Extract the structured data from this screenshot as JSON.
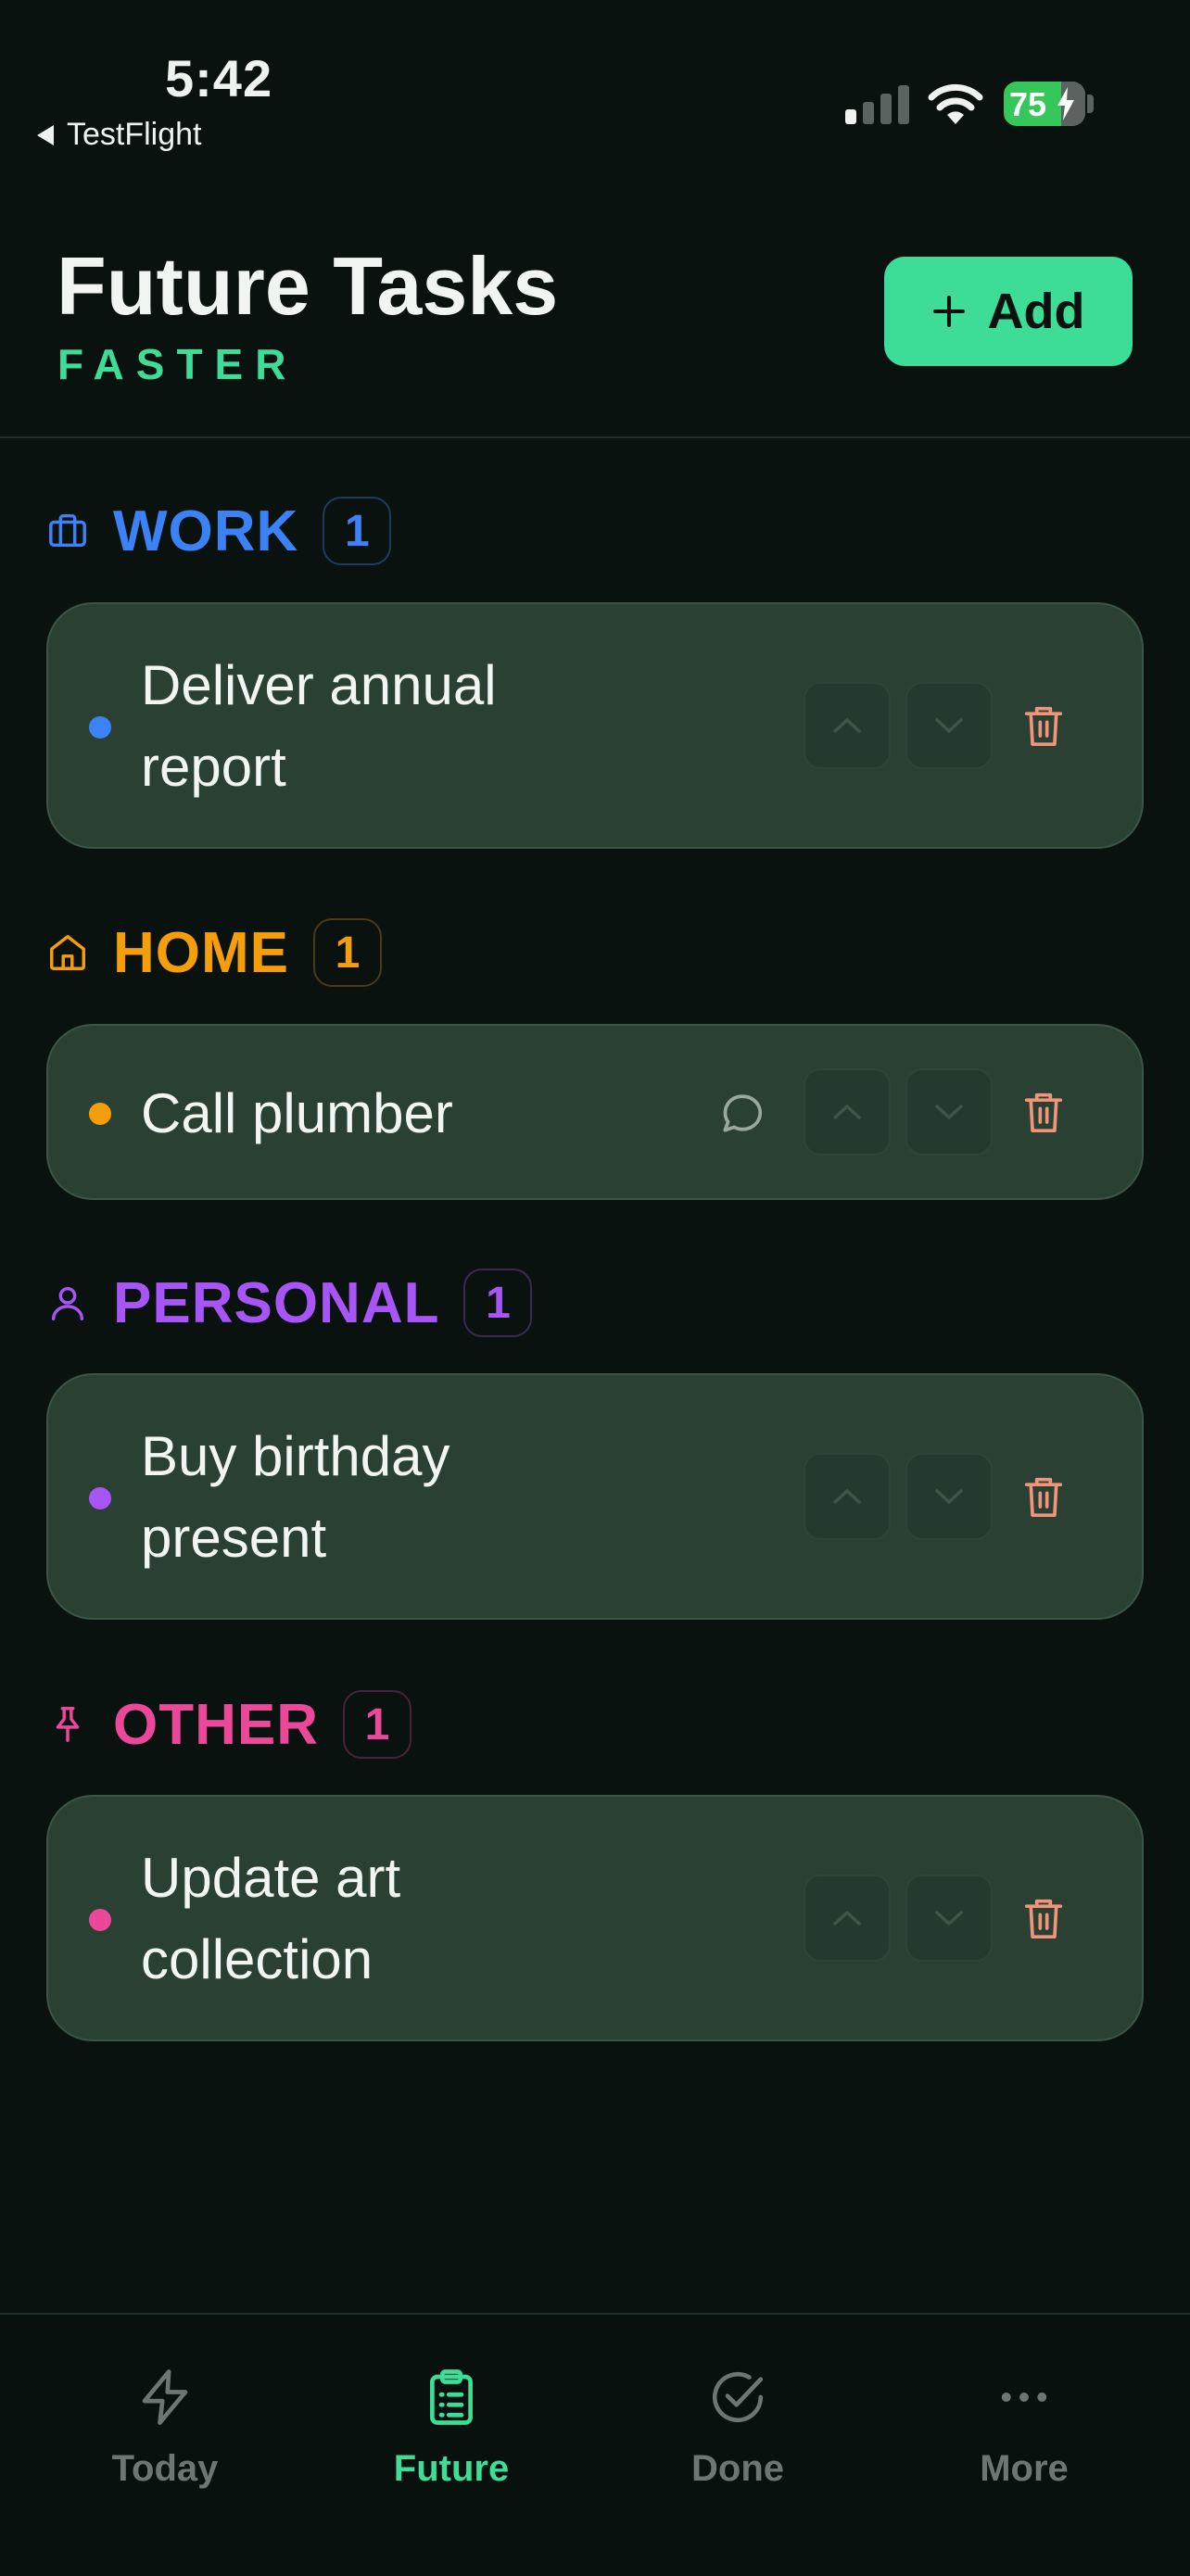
{
  "status_bar": {
    "time": "5:42",
    "back_app": "TestFlight",
    "battery_percent": "75"
  },
  "header": {
    "title": "Future Tasks",
    "subtitle": "FASTER",
    "add_label": "Add"
  },
  "colors": {
    "accent": "#3ddc97",
    "work": "#3b82f6",
    "home": "#f59e0b",
    "personal": "#a855f7",
    "other": "#ec4899",
    "trash": "#f0957a"
  },
  "sections": [
    {
      "key": "work",
      "icon": "briefcase-icon",
      "title": "WORK",
      "count": "1",
      "tasks": [
        {
          "line1": "Deliver annual",
          "line2": "report",
          "has_comment": false
        }
      ]
    },
    {
      "key": "home",
      "icon": "home-icon",
      "title": "HOME",
      "count": "1",
      "tasks": [
        {
          "line1": "Call plumber",
          "line2": "",
          "has_comment": true
        }
      ]
    },
    {
      "key": "personal",
      "icon": "user-icon",
      "title": "PERSONAL",
      "count": "1",
      "tasks": [
        {
          "line1": "Buy birthday",
          "line2": "present",
          "has_comment": false
        }
      ]
    },
    {
      "key": "other",
      "icon": "pin-icon",
      "title": "OTHER",
      "count": "1",
      "tasks": [
        {
          "line1": "Update art",
          "line2": "collection",
          "has_comment": false
        }
      ]
    }
  ],
  "tabs": [
    {
      "label": "Today",
      "icon": "lightning-icon",
      "active": false
    },
    {
      "label": "Future",
      "icon": "clipboard-icon",
      "active": true
    },
    {
      "label": "Done",
      "icon": "check-circle-icon",
      "active": false
    },
    {
      "label": "More",
      "icon": "more-icon",
      "active": false
    }
  ]
}
